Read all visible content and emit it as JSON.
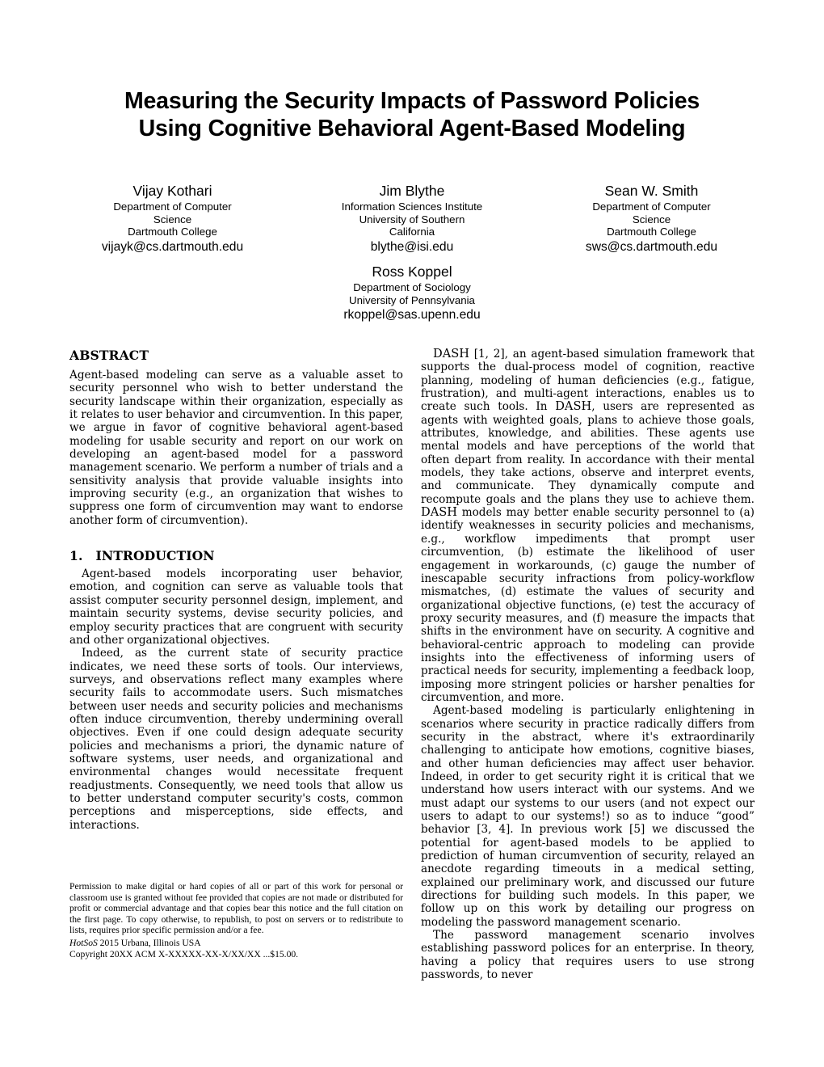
{
  "paper": {
    "title_lines": [
      "Measuring the Security Impacts of Password Policies",
      "Using Cognitive Behavioral Agent-Based Modeling"
    ],
    "authors": [
      {
        "name": "Vijay Kothari",
        "affiliation_lines": [
          "Department of Computer",
          "Science",
          "Dartmouth College"
        ],
        "email": "vijayk@cs.dartmouth.edu"
      },
      {
        "name": "Jim Blythe",
        "affiliation_lines": [
          "Information Sciences Institute",
          "University of Southern",
          "California"
        ],
        "email": "blythe@isi.edu"
      },
      {
        "name": "Sean W. Smith",
        "affiliation_lines": [
          "Department of Computer",
          "Science",
          "Dartmouth College"
        ],
        "email": "sws@cs.dartmouth.edu"
      }
    ],
    "author_solo": {
      "name": "Ross Koppel",
      "affiliation_lines": [
        "Department of Sociology",
        "University of Pennsylvania"
      ],
      "email": "rkoppel@sas.upenn.edu"
    },
    "abstract": {
      "heading": "ABSTRACT",
      "body": "Agent-based modeling can serve as a valuable asset to security personnel who wish to better understand the security landscape within their organization, especially as it relates to user behavior and circumvention. In this paper, we argue in favor of cognitive behavioral agent-based modeling for usable security and report on our work on developing an agent-based model for a password management scenario. We perform a number of trials and a sensitivity analysis that provide valuable insights into improving security (e.g., an organization that wishes to suppress one form of circumvention may want to endorse another form of circumvention)."
    },
    "introduction": {
      "number": "1.",
      "heading": "INTRODUCTION",
      "paragraphs": [
        "Agent-based models incorporating user behavior, emotion, and cognition can serve as valuable tools that assist computer security personnel design, implement, and maintain security systems, devise security policies, and employ security practices that are congruent with security and other organizational objectives.",
        "Indeed, as the current state of security practice indicates, we need these sorts of tools. Our interviews, surveys, and observations reflect many examples where security fails to accommodate users. Such mismatches between user needs and security policies and mechanisms often induce circumvention, thereby undermining overall objectives. Even if one could design adequate security policies and mechanisms a priori, the dynamic nature of software systems, user needs, and organizational and environmental changes would necessitate frequent readjustments. Consequently, we need tools that allow us to better understand computer security's costs, common perceptions and misperceptions, side effects, and interactions."
      ]
    },
    "right_column": {
      "para_dash_prefix": "DASH",
      "para_dash_rest": " [1, 2], an agent-based simulation framework that supports the dual-process model of cognition, reactive planning, modeling of human deficiencies (e.g., fatigue, frustration), and multi-agent interactions, enables us to create such tools. In ",
      "para_dash_sc2": "DASH",
      "para_dash_rest2": ", users are represented as agents with weighted goals, plans to achieve those goals, attributes, knowledge, and abilities. These agents use mental models and have perceptions of the world that often depart from reality. In accordance with their mental models, they take actions, observe and interpret events, and communicate. They dynamically compute and recompute goals and the plans they use to achieve them. ",
      "para_dash_sc3": "DASH",
      "para_dash_rest3": " models may better enable security personnel to (a) identify weaknesses in security policies and mechanisms, e.g., workflow impediments that prompt user circumvention, (b) estimate the likelihood of user engagement in workarounds, (c) gauge the number of inescapable security infractions from policy-workflow mismatches, (d) estimate the values of security and organizational objective functions, (e) test the accuracy of proxy security measures, and (f) measure the impacts that shifts in the environment have on security. A cognitive and behavioral-centric approach to modeling can provide insights into the effectiveness of informing users of practical needs for security, implementing a feedback loop, imposing more stringent policies or harsher penalties for circumvention, and more.",
      "para_2": "Agent-based modeling is particularly enlightening in scenarios where security in practice radically differs from security in the abstract, where it's extraordinarily challenging to anticipate how emotions, cognitive biases, and other human deficiencies may affect user behavior. Indeed, in order to get security right it is critical that we understand how users interact with our systems. And we must adapt our systems to our users (and not expect our users to adapt to our systems!) so as to induce “good” behavior [3, 4]. In previous work [5] we discussed the potential for agent-based models to be applied to prediction of human circumvention of security, relayed an anecdote regarding timeouts in a medical setting, explained our preliminary work, and discussed our future directions for building such models. In this paper, we follow up on this work by detailing our progress on modeling the password management scenario.",
      "para_3": "The password management scenario involves establishing password polices for an enterprise. In theory, having a policy that requires users to use strong passwords, to never"
    },
    "copyright": {
      "permission": "Permission to make digital or hard copies of all or part of this work for personal or classroom use is granted without fee provided that copies are not made or distributed for profit or commercial advantage and that copies bear this notice and the full citation on the first page. To copy otherwise, to republish, to post on servers or to redistribute to lists, requires prior specific permission and/or a fee.",
      "venue_italic": "HotSoS",
      "venue_rest": " 2015 Urbana, Illinois USA",
      "copyright_line": "Copyright 20XX ACM X-XXXXX-XX-X/XX/XX ...$15.00."
    }
  }
}
